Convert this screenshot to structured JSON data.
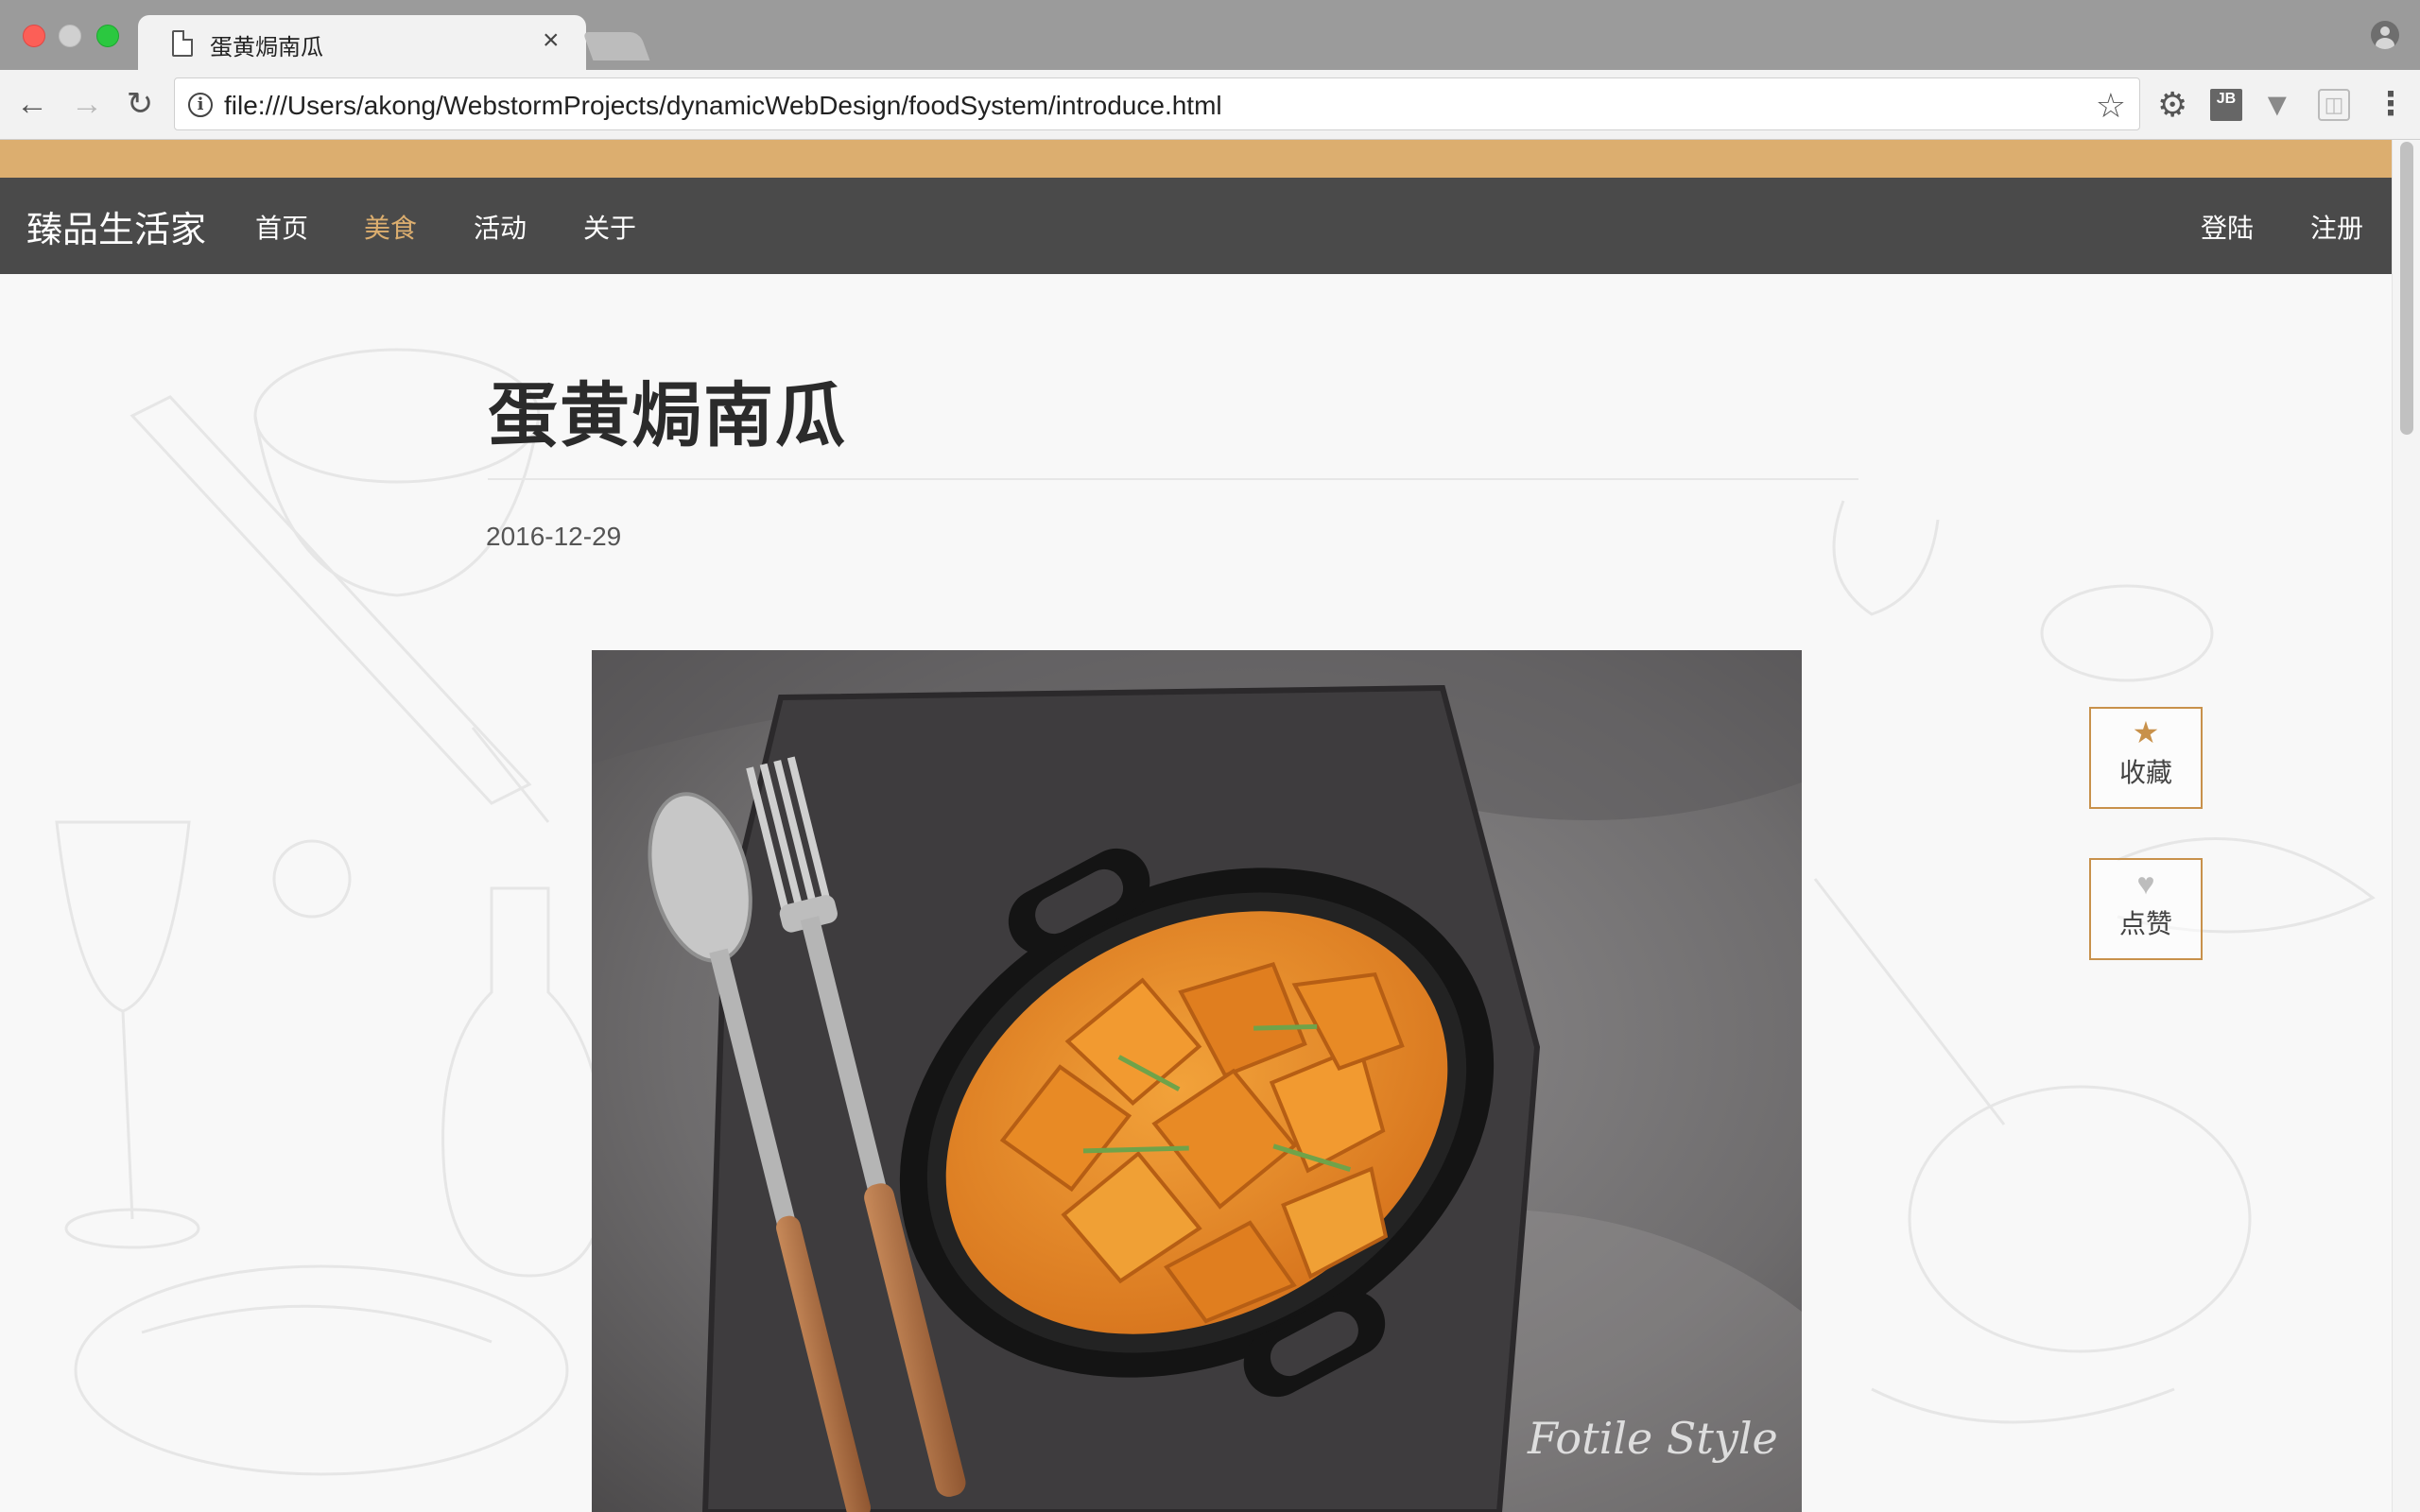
{
  "browser": {
    "tab_title": "蛋黄焗南瓜",
    "tab_close": "×",
    "url": "file:///Users/akong/WebstormProjects/dynamicWebDesign/foodSystem/introduce.html",
    "back": "←",
    "forward": "→",
    "reload": "↻",
    "bookmark_star": "☆",
    "menu": "⋮",
    "ext_jb": "JB"
  },
  "site": {
    "brand": "臻品生活家",
    "nav": [
      "首页",
      "美食",
      "活动",
      "关于"
    ],
    "active_nav": "美食",
    "auth": {
      "login": "登陆",
      "register": "注册"
    },
    "accent_color": "#dcae6f",
    "nav_bg": "#4a4a4a"
  },
  "article": {
    "title": "蛋黄焗南瓜",
    "date": "2016-12-29",
    "image_watermark": "Fotile Style"
  },
  "actions": {
    "favorite": {
      "icon": "★",
      "label": "收藏"
    },
    "like": {
      "icon": "♥",
      "label": "点赞"
    }
  }
}
